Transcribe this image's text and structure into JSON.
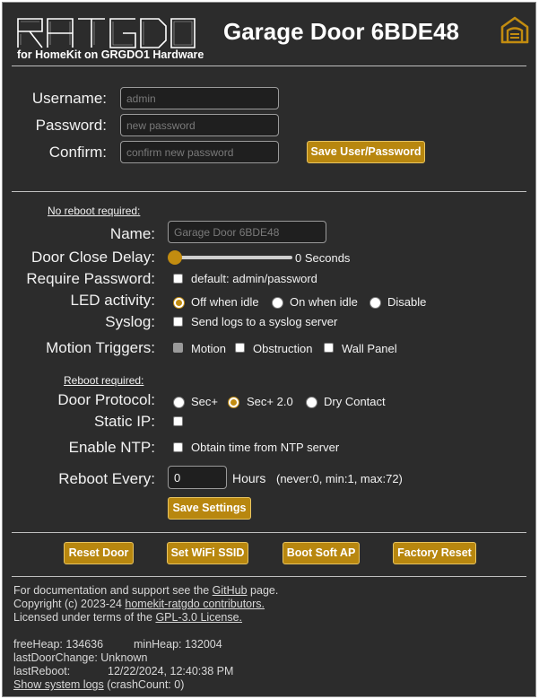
{
  "header": {
    "logo_text": "RATGDO",
    "subtitle": "for HomeKit on GRGDO1 Hardware",
    "title": "Garage Door 6BDE48",
    "home_icon": "garage-home-icon",
    "accent_color": "#c28c10"
  },
  "account": {
    "username_label": "Username:",
    "username_placeholder": "admin",
    "password_label": "Password:",
    "password_placeholder": "new password",
    "confirm_label": "Confirm:",
    "confirm_placeholder": "confirm new password",
    "save_label": "Save User/Password"
  },
  "settings": {
    "no_reboot_heading": "No reboot required:",
    "name_label": "Name:",
    "name_placeholder": "Garage Door 6BDE48",
    "door_close_delay_label": "Door Close Delay:",
    "door_close_delay_value": "0 Seconds",
    "door_close_delay_level": 0,
    "require_password_label": "Require Password:",
    "require_password_text": "default: admin/password",
    "led_label": "LED activity:",
    "led_options": [
      "Off when idle",
      "On when idle",
      "Disable"
    ],
    "led_selected": "Off when idle",
    "syslog_label": "Syslog:",
    "syslog_text": "Send logs to a syslog server",
    "motion_label": "Motion Triggers:",
    "motion_options": [
      "Motion",
      "Obstruction",
      "Wall Panel"
    ],
    "reboot_heading": "Reboot required:",
    "protocol_label": "Door Protocol:",
    "protocol_options": [
      "Sec+",
      "Sec+ 2.0",
      "Dry Contact"
    ],
    "protocol_selected": "Sec+ 2.0",
    "static_ip_label": "Static IP:",
    "ntp_label": "Enable NTP:",
    "ntp_text": "Obtain time from NTP server",
    "reboot_every_label": "Reboot Every:",
    "reboot_every_value": "0",
    "reboot_every_unit": "Hours",
    "reboot_every_hint": "(never:0, min:1, max:72)",
    "save_label": "Save Settings"
  },
  "actions": {
    "reset_door": "Reset Door",
    "set_wifi": "Set WiFi SSID",
    "boot_soft_ap": "Boot Soft AP",
    "factory_reset": "Factory Reset"
  },
  "footer": {
    "doc_prefix": "For documentation and support see the ",
    "doc_link": "GitHub",
    "doc_suffix": " page.",
    "copyright_prefix": "Copyright (c) 2023-24 ",
    "copyright_link": "homekit-ratgdo contributors.",
    "license_prefix": "Licensed under terms of the ",
    "license_link": "GPL-3.0 License.",
    "free_heap": "freeHeap: 134636",
    "min_heap": "minHeap: 132004",
    "last_door_change": "lastDoorChange: Unknown",
    "last_reboot_label": "lastReboot:",
    "last_reboot_value": "12/22/2024, 12:40:38 PM",
    "syslog_link": "Show system logs",
    "crash_count": " (crashCount: 0)"
  }
}
